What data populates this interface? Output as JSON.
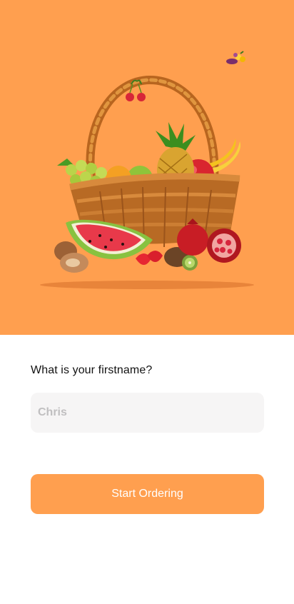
{
  "colors": {
    "hero_background": "#ff9f4f",
    "accent": "#ff9f4f",
    "input_background": "#f6f5f5",
    "text": "#121212",
    "placeholder": "#c0bfc0"
  },
  "hero": {
    "illustration": "fruit-basket-illustration"
  },
  "form": {
    "question": "What is your firstname?",
    "name_value": "",
    "name_placeholder": "Chris",
    "submit_label": "Start Ordering"
  }
}
